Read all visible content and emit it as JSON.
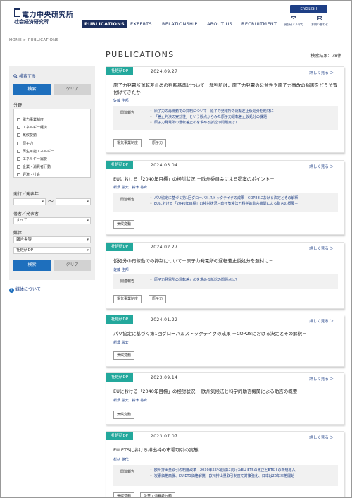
{
  "header": {
    "logo_main": "電力中央研究所",
    "logo_sub": "社会経済研究所",
    "lang_button": "ENGLISH",
    "nav": [
      "PUBLICATIONS",
      "EXPERTS",
      "RELATIONSHIP",
      "ABOUT US",
      "RECRUITMENT"
    ],
    "utils": [
      {
        "icon": "mail-icon",
        "label": "現役研メルマガ"
      },
      {
        "icon": "envelope-icon",
        "label": "お問い合わせ"
      }
    ]
  },
  "breadcrumb": "HOME > PUBLICATIONS",
  "page": {
    "title": "PUBLICATIONS",
    "results": "検索結果：78件"
  },
  "sidebar": {
    "search_title": "検索する",
    "search_button": "検索",
    "clear_button": "クリア",
    "field_label": "分野",
    "fields": [
      "電力事業制度",
      "エネルギー経済",
      "気候変動",
      "原子力",
      "再生可能エネルギー",
      "エネルギー需要",
      "企業・消費者行動",
      "経済・社会"
    ],
    "date_label": "発行／発表年",
    "date_tilde": "〜",
    "author_label": "著者／発表者",
    "author_value": "すべて",
    "media_label": "媒体",
    "media_value1": "報告書等",
    "media_value2": "社経研DP",
    "search_button2": "検索",
    "clear_button2": "クリア",
    "media_link": "媒体について"
  },
  "cards": [
    {
      "badge": "社経研DP",
      "date": "2024.09.27",
      "more": "詳しく見る ＞",
      "title": "原子力発電所運転差止めの判断基準について－裁判所は，原子力発電の公益性や原子力事故の損害をどう位置付けてきたか－",
      "authors": "佐藤 佳邦",
      "related_label": "関連報告",
      "related": [
        "原子力の再稼動での抑制について－原子力発電所の運転差止仮処分を題材に－",
        "「差止判決の実効性」という観点からみた原子力運転差止仮処分の課題",
        "原子力発電所の運転差止めを求める訴訟の問題点は？"
      ],
      "tags": [
        "電気事業制度",
        "原子力"
      ]
    },
    {
      "badge": "社経研DP",
      "date": "2024.03.04",
      "more": "詳しく見る ＞",
      "title": "EUにおける「2040年目標」の検討状況 －欧州委員会による提案のポイント－",
      "authors": "新畑 駿太　鈴木 将斉",
      "related_label": "関連報告",
      "related": [
        "パリ協定に基づく第1回グローバルストックテイクの成果－COP28における決定とその解釈－",
        "EUにおける「2040年目標」の検討状況－欧州気候法と科学的助言機関による助言の概要－"
      ],
      "tags": [
        "気候変動"
      ]
    },
    {
      "badge": "社経研DP",
      "date": "2024.02.27",
      "more": "詳しく見る ＞",
      "title": "仮処分の再稼動での抑制について－原子力発電所の運転差止仮処分を題材に－",
      "authors": "佐藤 佳邦",
      "related_label": "関連報告",
      "related": [
        "原子力発電所の運転差止めを求める訴訟の問題点は？"
      ],
      "tags": [
        "電気事業制度",
        "原子力"
      ]
    },
    {
      "badge": "社経研DP",
      "date": "2024.01.22",
      "more": "詳しく見る ＞",
      "title": "パリ協定に基づく第1回グローバルストックテイクの成果 －COP28における決定とその解釈－",
      "authors": "新畑 駿太",
      "related_label": "",
      "related": [],
      "tags": [
        "気候変動"
      ]
    },
    {
      "badge": "社経研DP",
      "date": "2023.09.14",
      "more": "詳しく見る ＞",
      "title": "EUにおける「2040年目標」の検討状況 －欧州気候法と科学的助言機関による助言の概要－",
      "authors": "新畑 駿太　鈴木 将斉",
      "related_label": "",
      "related": [],
      "tags": [
        "気候変動"
      ]
    },
    {
      "badge": "社経研DP",
      "date": "2023.07.07",
      "more": "詳しく見る ＞",
      "title": "EU ETSにおける排出枠の市場取引の実態",
      "authors": "杉材 英代",
      "related_label": "関連報告",
      "related": [
        "欧州排出量取引の制度改革　2030年55%削減に向けたEU ETSの改正とETS IIの新規導入",
        "炭素価格高騰、EU ETS価格解説　欧州排出量取引制度で対策強化、日本は26年本格開始"
      ],
      "tags": [
        "気候変動",
        "企業・消費者行動"
      ]
    }
  ]
}
